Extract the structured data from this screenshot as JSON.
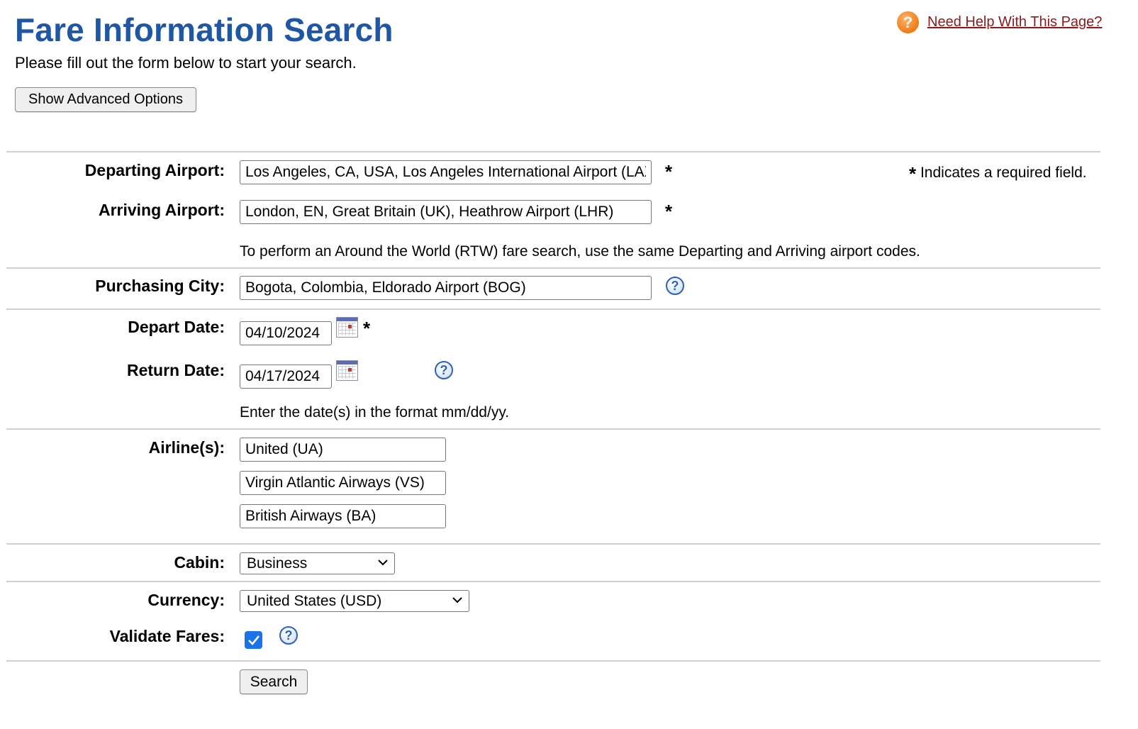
{
  "page": {
    "title": "Fare Information Search",
    "subtitle": "Please fill out the form below to start your search.",
    "advanced_button": "Show Advanced Options",
    "help_link": "Need Help With This Page?",
    "help_icon_glyph": "?",
    "required_marker": "*",
    "required_note": "Indicates a required field."
  },
  "form": {
    "departing": {
      "label": "Departing Airport:",
      "value": "Los Angeles, CA, USA, Los Angeles International Airport (LAX)"
    },
    "arriving": {
      "label": "Arriving Airport:",
      "value": "London, EN, Great Britain (UK), Heathrow Airport (LHR)"
    },
    "rtw_note": "To perform an Around the World (RTW) fare search, use the same Departing and Arriving airport codes.",
    "purchasing": {
      "label": "Purchasing City:",
      "value": "Bogota, Colombia, Eldorado Airport (BOG)"
    },
    "depart_date": {
      "label": "Depart Date:",
      "value": "04/10/2024"
    },
    "return_date": {
      "label": "Return Date:",
      "value": "04/17/2024"
    },
    "date_note": "Enter the date(s) in the format mm/dd/yy.",
    "airlines": {
      "label": "Airline(s):",
      "values": [
        "United (UA)",
        "Virgin Atlantic Airways (VS)",
        "British Airways (BA)"
      ]
    },
    "cabin": {
      "label": "Cabin:",
      "value": "Business"
    },
    "currency": {
      "label": "Currency:",
      "value": "United States (USD)"
    },
    "validate": {
      "label": "Validate Fares:",
      "checked": true
    },
    "search_button": "Search"
  },
  "colors": {
    "title": "#1f57a4",
    "help_link": "#8b1a1a",
    "help_orange": "#f07a14",
    "help_blue": "#2f63b1",
    "checkbox": "#1a73e8"
  },
  "icons": {
    "help": "orange-question-icon",
    "field_help": "blue-question-icon",
    "calendar": "calendar-icon",
    "dropdown": "chevron-down-icon",
    "check": "checkmark-icon"
  }
}
